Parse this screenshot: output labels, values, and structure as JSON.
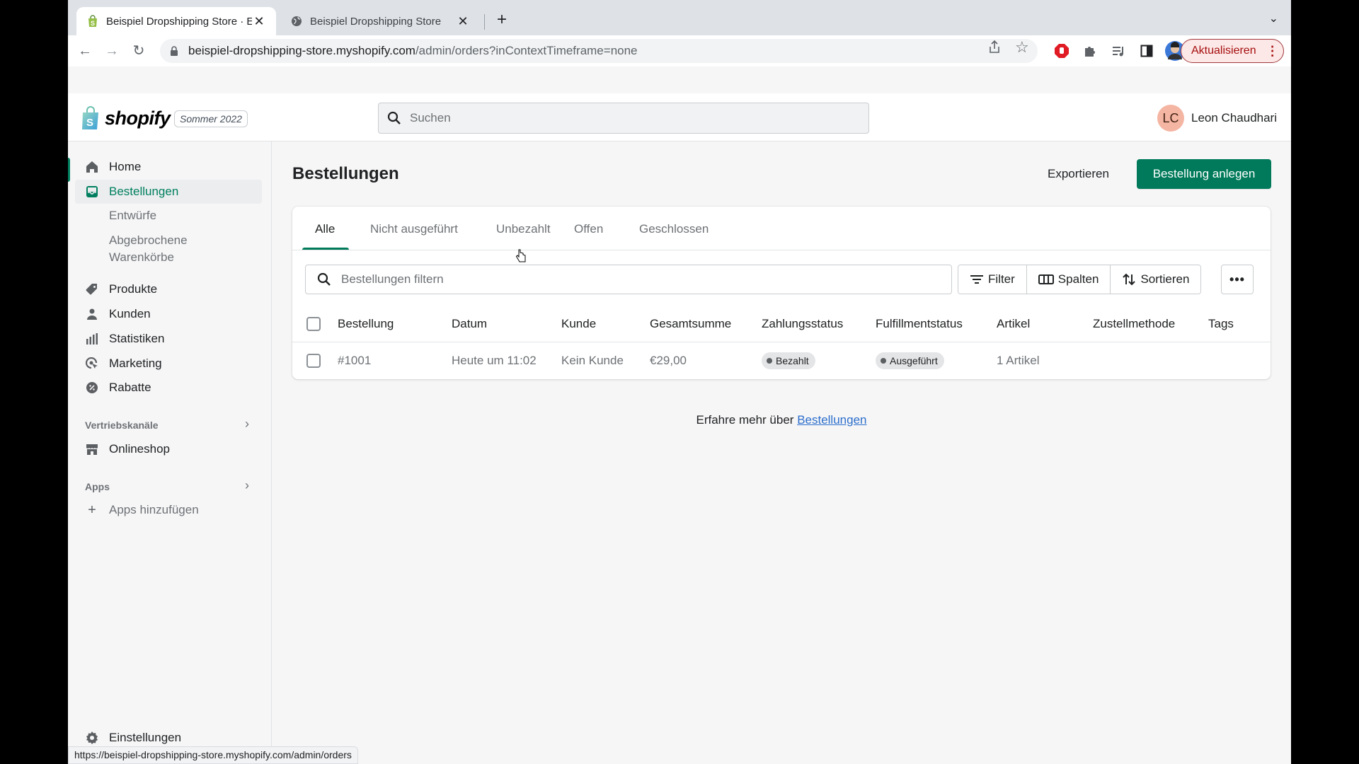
{
  "browser": {
    "tabs": [
      {
        "title": "Beispiel Dropshipping Store · E",
        "favicon": "shopify-bag-icon",
        "active": true
      },
      {
        "title": "Beispiel Dropshipping Store",
        "favicon": "globe-icon",
        "active": false
      }
    ],
    "url_host": "beispiel-dropshipping-store.myshopify.com",
    "url_path": "/admin/orders?inContextTimeframe=none",
    "update_label": "Aktualisieren",
    "status_url": "https://beispiel-dropshipping-store.myshopify.com/admin/orders"
  },
  "topbar": {
    "brand": "shopify",
    "release_badge": "Sommer 2022",
    "search_placeholder": "Suchen",
    "user_initials": "LC",
    "user_name": "Leon Chaudhari",
    "avatar_color": "#f5b5a3"
  },
  "sidebar": {
    "items": [
      {
        "label": "Home",
        "icon": "home-icon"
      },
      {
        "label": "Bestellungen",
        "icon": "orders-icon",
        "active": true
      },
      {
        "label": "Produkte",
        "icon": "tag-icon"
      },
      {
        "label": "Kunden",
        "icon": "person-icon"
      },
      {
        "label": "Statistiken",
        "icon": "bar-chart-icon"
      },
      {
        "label": "Marketing",
        "icon": "target-icon"
      },
      {
        "label": "Rabatte",
        "icon": "discount-icon"
      }
    ],
    "sub_items": [
      "Entwürfe",
      "Abgebrochene",
      "Warenkörbe"
    ],
    "sales_channels_label": "Vertriebskanäle",
    "online_store": "Onlineshop",
    "apps_label": "Apps",
    "add_apps": "Apps hinzufügen",
    "settings": "Einstellungen"
  },
  "main": {
    "title": "Bestellungen",
    "export_label": "Exportieren",
    "create_label": "Bestellung anlegen",
    "accent": "#007a5a",
    "tabs": [
      "Alle",
      "Nicht ausgeführt",
      "Unbezahlt",
      "Offen",
      "Geschlossen"
    ],
    "filter_placeholder": "Bestellungen filtern",
    "filter_label": "Filter",
    "columns_label": "Spalten",
    "sort_label": "Sortieren",
    "table": {
      "headers": [
        "Bestellung",
        "Datum",
        "Kunde",
        "Gesamtsumme",
        "Zahlungsstatus",
        "Fulfillmentstatus",
        "Artikel",
        "Zustellmethode",
        "Tags"
      ],
      "rows": [
        {
          "order": "#1001",
          "date": "Heute um 11:02",
          "customer": "Kein Kunde",
          "total": "€29,00",
          "payment": "Bezahlt",
          "fulfillment": "Ausgeführt",
          "items": "1 Artikel",
          "delivery": "",
          "tags": ""
        }
      ]
    },
    "learn_prefix": "Erfahre mehr über",
    "learn_link": "Bestellungen"
  }
}
